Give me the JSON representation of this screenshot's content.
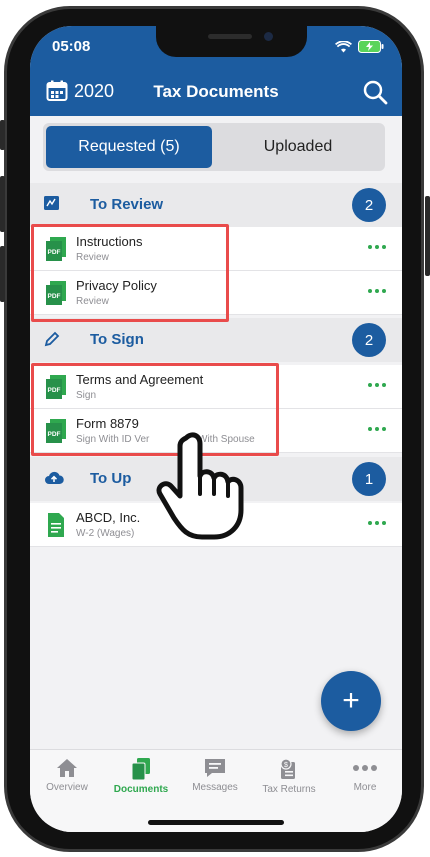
{
  "status_bar": {
    "time": "05:08"
  },
  "header": {
    "year": "2020",
    "title": "Tax Documents"
  },
  "segments": {
    "requested_label": "Requested (5)",
    "uploaded_label": "Uploaded"
  },
  "sections": [
    {
      "title": "To Review",
      "count": "2"
    },
    {
      "title": "To Sign",
      "count": "2"
    },
    {
      "title": "To Up",
      "count": "1"
    }
  ],
  "documents": {
    "review": [
      {
        "name": "Instructions",
        "subtitle": "Review",
        "icon": "pdf-icon"
      },
      {
        "name": "Privacy Policy",
        "subtitle": "Review",
        "icon": "pdf-icon"
      }
    ],
    "sign": [
      {
        "name": "Terms and Agreement",
        "subtitle": "Sign",
        "icon": "pdf-icon"
      },
      {
        "name": "Form 8879",
        "subtitle": "Sign With ID Ver",
        "subtitle_tail": "With Spouse",
        "icon": "pdf-icon"
      }
    ],
    "upload": [
      {
        "name": "ABCD, Inc.",
        "subtitle": "W-2 (Wages)",
        "icon": "document-icon"
      }
    ]
  },
  "fab": {
    "label": "+"
  },
  "tab_bar": [
    {
      "label": "Overview",
      "icon": "home-icon"
    },
    {
      "label": "Documents",
      "icon": "documents-icon",
      "active": true
    },
    {
      "label": "Messages",
      "icon": "messages-icon"
    },
    {
      "label": "Tax Returns",
      "icon": "tax-returns-icon"
    },
    {
      "label": "More",
      "icon": "more-icon"
    }
  ],
  "colors": {
    "primary": "#1c5ca0",
    "accent_green": "#2fa84f",
    "highlight_red": "#e94b4b",
    "background": "#f2f2f4"
  }
}
